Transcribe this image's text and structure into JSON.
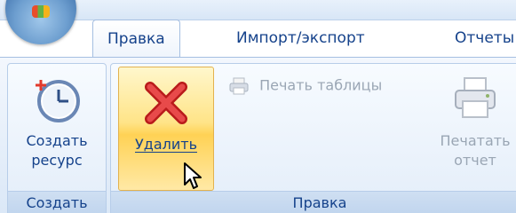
{
  "tabs": [
    {
      "label": "Правка",
      "active": true
    },
    {
      "label": "Импорт/экспорт",
      "active": false
    },
    {
      "label": "Отчеты",
      "active": false
    }
  ],
  "groups": {
    "create": {
      "label": "Создать",
      "create_resource": {
        "line1": "Создать",
        "line2": "ресурс",
        "icon": "clock-add-icon"
      }
    },
    "edit": {
      "label": "Правка",
      "delete": {
        "label": "Удалить",
        "icon": "red-x-icon"
      },
      "print_table": {
        "label": "Печать таблицы",
        "icon": "printer-icon",
        "enabled": false
      },
      "print_report": {
        "line1": "Печатать",
        "line2": "отчет",
        "icon": "printer-icon",
        "enabled": false
      }
    }
  },
  "colors": {
    "tab_text": "#15428b",
    "disabled_text": "#9aa6b4",
    "highlight": "#ffe488"
  }
}
